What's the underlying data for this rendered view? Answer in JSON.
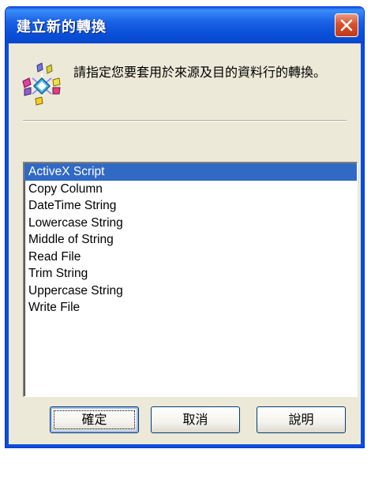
{
  "window": {
    "title": "建立新的轉換"
  },
  "instruction": "請指定您要套用於來源及目的資料行的轉換。",
  "transformations": {
    "selected_index": 0,
    "items": [
      "ActiveX Script",
      "Copy Column",
      "DateTime String",
      "Lowercase String",
      "Middle of String",
      "Read File",
      "Trim String",
      "Uppercase String",
      "Write File"
    ]
  },
  "buttons": {
    "ok": "確定",
    "cancel": "取消",
    "help": "說明"
  },
  "icons": {
    "close": "close-icon",
    "dialog": "dts-transform-icon"
  },
  "colors": {
    "titlebar": "#0a4fd8",
    "selection": "#316ac5",
    "close": "#d8502c",
    "dialog_bg": "#ece9d8"
  }
}
